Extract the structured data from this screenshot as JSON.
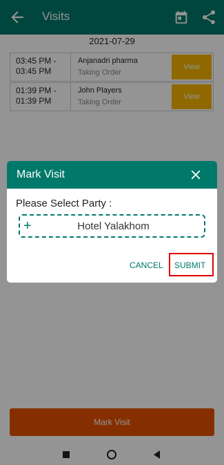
{
  "appbar": {
    "title": "Visits",
    "back_icon": "arrow-left-icon",
    "calendar_icon": "calendar-icon",
    "share_icon": "share-icon",
    "color": "#00796b"
  },
  "date": "2021-07-29",
  "visits": [
    {
      "time_start": "03:45 PM -",
      "time_end": "03:45 PM",
      "party": "Anjanadri pharma",
      "status": "Taking Order",
      "view_label": "View"
    },
    {
      "time_start": "01:39 PM -",
      "time_end": "01:39 PM",
      "party": "John Players",
      "status": "Taking Order",
      "view_label": "View"
    }
  ],
  "mark_visit_label": "Mark Visit",
  "dialog": {
    "title": "Mark Visit",
    "prompt": "Please Select Party :",
    "selected_party": "Hotel Yalakhom",
    "add_symbol": "+",
    "cancel_label": "CANCEL",
    "submit_label": "SUBMIT"
  },
  "colors": {
    "primary": "#00796b",
    "view_button": "#f7b500",
    "mark_visit_button": "#e65100",
    "highlight": "#e00000"
  }
}
